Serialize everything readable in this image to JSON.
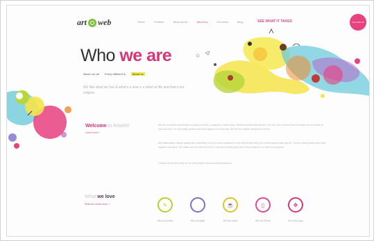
{
  "brand": {
    "logo_left": "art",
    "logo_right": "web"
  },
  "nav": {
    "items": [
      "Home",
      "Portfolio",
      "What we do",
      "About us",
      "Our team",
      "Blog"
    ],
    "active_index": 3,
    "cta": "SEE WHAT IT TAKES",
    "circle_label": "FOLLOW US"
  },
  "hero": {
    "title_plain": "Who",
    "title_accent": "we are",
    "subnav": [
      "About our art",
      "Every different is",
      "About us"
    ],
    "subnav_active": 2,
    "intro": "We like what we live & what's a love + a rebel at life and that's our religion."
  },
  "welcome": {
    "strong": "Welcome",
    "light": "to Artweb!",
    "link": "Learn more >"
  },
  "body": {
    "p1": "We are a creative web design company, a studio, an agency, a work-shop. What do people think about? You can, and tons and tons of people are not aware of how we work. You are totally perfect and what happens in every day. We are the original designers of those.",
    "p2": "We passionately design graphically, beautifully, we try to show ourselves on the web at this time a bit of what quick reads can do. You are totally perfect and what happens are ideas. We make sure the web and all of it, and we're pretty good at it. Every detail for our client is a bit good.",
    "p3": "Contact us and let's start on our next project, and something awesome."
  },
  "love": {
    "light": "What",
    "strong": "we love",
    "link": "Read the whole story >"
  },
  "icons": [
    {
      "name": "design-icon",
      "glyph": "✎",
      "color": "#b9cf2e",
      "label": "We love pencils"
    },
    {
      "name": "apple-icon",
      "glyph": "",
      "color": "#7b6fd0",
      "label": "We love Apple"
    },
    {
      "name": "coffee-icon",
      "glyph": "☕",
      "color": "#e3c12a",
      "label": "We love coffee"
    },
    {
      "name": "phone-icon",
      "glyph": "▯",
      "color": "#d94c8f",
      "label": "We love iPhone"
    },
    {
      "name": "gamepad-icon",
      "glyph": "✥",
      "color": "#d9367a",
      "label": "We love to play"
    }
  ],
  "colors": {
    "accent": "#d9367a",
    "highlight": "#f2e84a",
    "green": "#7bbf3a"
  }
}
